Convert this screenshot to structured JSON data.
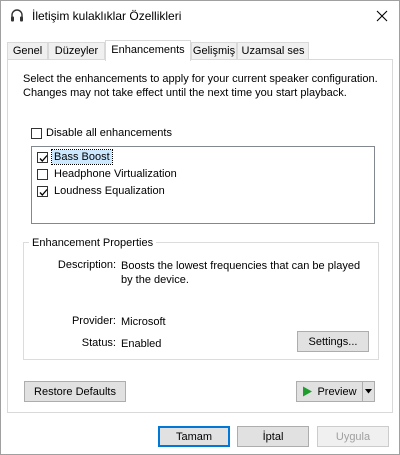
{
  "window": {
    "title": "İletişim kulaklıklar Özellikleri",
    "icon": "headset-icon"
  },
  "tabs": [
    {
      "label": "Genel",
      "active": false
    },
    {
      "label": "Düzeyler",
      "active": false
    },
    {
      "label": "Enhancements",
      "active": true
    },
    {
      "label": "Gelişmiş",
      "active": false
    },
    {
      "label": "Uzamsal ses",
      "active": false
    }
  ],
  "enhancements": {
    "description": "Select the enhancements to apply for your current speaker configuration. Changes may not take effect until the next time you start playback.",
    "disable_all_label": "Disable all enhancements",
    "disable_all_checked": false,
    "items": [
      {
        "label": "Bass Boost",
        "checked": true,
        "selected": true
      },
      {
        "label": "Headphone Virtualization",
        "checked": false,
        "selected": false
      },
      {
        "label": "Loudness Equalization",
        "checked": true,
        "selected": false
      }
    ]
  },
  "properties": {
    "group_title": "Enhancement Properties",
    "description_label": "Description:",
    "description_value": "Boosts the lowest frequencies that can be played by the device.",
    "provider_label": "Provider:",
    "provider_value": "Microsoft",
    "status_label": "Status:",
    "status_value": "Enabled",
    "settings_button": "Settings..."
  },
  "buttons": {
    "restore_defaults": "Restore Defaults",
    "preview": "Preview",
    "ok": "Tamam",
    "cancel": "İptal",
    "apply": "Uygula"
  },
  "colors": {
    "accent": "#0078d7",
    "selection": "#cce8ff",
    "play_green": "#1e9e2e"
  }
}
